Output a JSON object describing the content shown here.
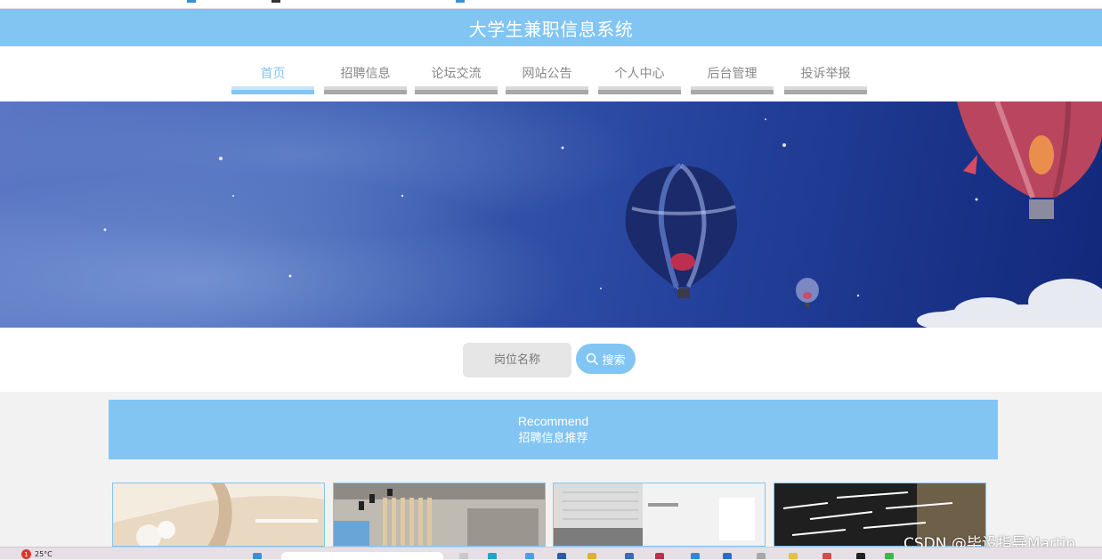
{
  "header": {
    "title": "大学生兼职信息系统"
  },
  "nav": {
    "items": [
      {
        "label": "首页",
        "active": true
      },
      {
        "label": "招聘信息",
        "active": false
      },
      {
        "label": "论坛交流",
        "active": false
      },
      {
        "label": "网站公告",
        "active": false
      },
      {
        "label": "个人中心",
        "active": false
      },
      {
        "label": "后台管理",
        "active": false
      },
      {
        "label": "投诉举报",
        "active": false
      }
    ]
  },
  "search": {
    "placeholder": "岗位名称",
    "button_label": "搜索",
    "button_icon": "search-icon"
  },
  "recommend": {
    "title_en": "Recommend",
    "title_zh": "招聘信息推荐"
  },
  "watermark": "CSDN @毕设指导Martin",
  "taskbar": {
    "weather_badge": "1",
    "temperature": "25°C"
  },
  "colors": {
    "accent": "#82c5f3",
    "nav_text": "#888888",
    "page_background": "#f2f2f2"
  }
}
